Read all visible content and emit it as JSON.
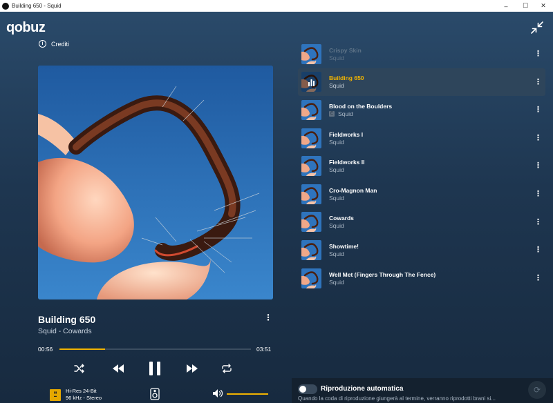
{
  "window": {
    "title": "Building 650 - Squid",
    "minimize": "–",
    "maximize": "☐",
    "close": "✕"
  },
  "brand": {
    "logo": "qobuz"
  },
  "credits_label": "Crediti",
  "now_playing": {
    "title": "Building 650",
    "subtitle": "Squid - Cowards",
    "elapsed": "00:56",
    "duration": "03:51",
    "progress": 0.24
  },
  "quality": {
    "line1": "Hi-Res 24-Bit",
    "line2": "96 kHz - Stereo"
  },
  "volume_level": 1.0,
  "queue": [
    {
      "title": "Crispy Skin",
      "artist": "Squid",
      "state": "past",
      "explicit": false
    },
    {
      "title": "Building 650",
      "artist": "Squid",
      "state": "active",
      "explicit": false
    },
    {
      "title": "Blood on the Boulders",
      "artist": "Squid",
      "state": "upcoming",
      "explicit": true
    },
    {
      "title": "Fieldworks I",
      "artist": "Squid",
      "state": "upcoming",
      "explicit": false
    },
    {
      "title": "Fieldworks II",
      "artist": "Squid",
      "state": "upcoming",
      "explicit": false
    },
    {
      "title": "Cro-Magnon Man",
      "artist": "Squid",
      "state": "upcoming",
      "explicit": false
    },
    {
      "title": "Cowards",
      "artist": "Squid",
      "state": "upcoming",
      "explicit": false
    },
    {
      "title": "Showtime!",
      "artist": "Squid",
      "state": "upcoming",
      "explicit": false
    },
    {
      "title": "Well Met (Fingers Through The Fence)",
      "artist": "Squid",
      "state": "upcoming",
      "explicit": false
    }
  ],
  "explicit_mark": "E",
  "autoplay": {
    "label": "Riproduzione automatica",
    "description": "Quando la coda di riproduzione giungerà al termine, verranno riprodotti brani si...",
    "enabled": false
  },
  "colors": {
    "accent": "#f2b400",
    "background_top": "#2a4a6a",
    "background_bottom": "#172a3f",
    "cover_sky": "#2b6db5"
  },
  "icons": {
    "info": "info-icon",
    "collapse": "collapse-icon",
    "shuffle": "shuffle-icon",
    "previous": "previous-icon",
    "pause": "pause-icon",
    "next": "next-icon",
    "repeat": "repeat-icon",
    "device": "device-icon",
    "volume": "volume-icon",
    "more": "more-vertical-icon",
    "refresh": "refresh-icon"
  }
}
